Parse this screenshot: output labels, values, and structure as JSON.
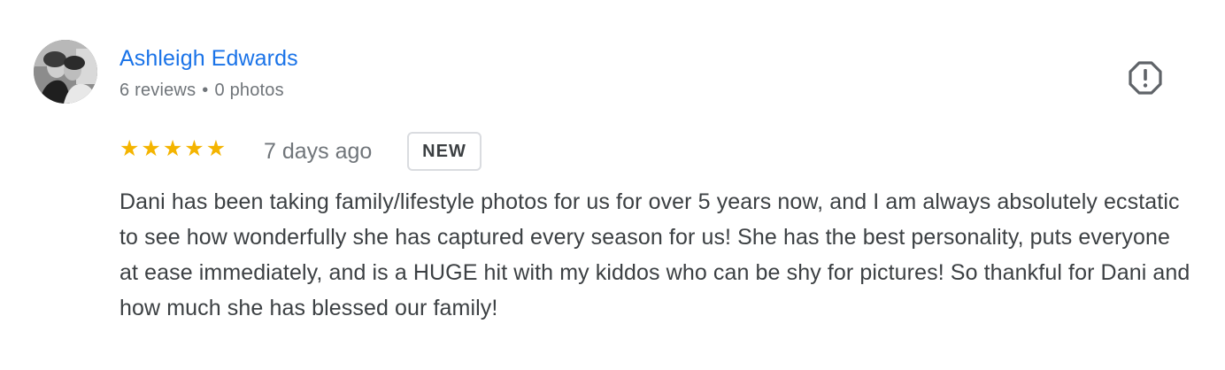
{
  "review": {
    "author": {
      "name": "Ashleigh Edwards",
      "reviews": "6 reviews",
      "separator": "•",
      "photos": "0 photos",
      "avatar_icon": "profile-photo"
    },
    "flag_icon": "report-flag-icon",
    "rating": {
      "value": 5,
      "max": 5,
      "star_color": "#f4b400",
      "star_glyph": "★"
    },
    "date": "7 days ago",
    "badge": "NEW",
    "text": "Dani has been taking family/lifestyle photos for us for over 5 years now, and I am always absolutely ecstatic to see how wonderfully she has captured every season for us! She has the best personality, puts everyone at ease immediately, and is a HUGE hit with my kiddos who can be shy for pictures! So thankful for Dani and how much she has blessed our family!"
  },
  "colors": {
    "link": "#1a73e8",
    "meta": "#70757a",
    "body_text": "#3c4043",
    "badge_border": "#dadce0"
  }
}
